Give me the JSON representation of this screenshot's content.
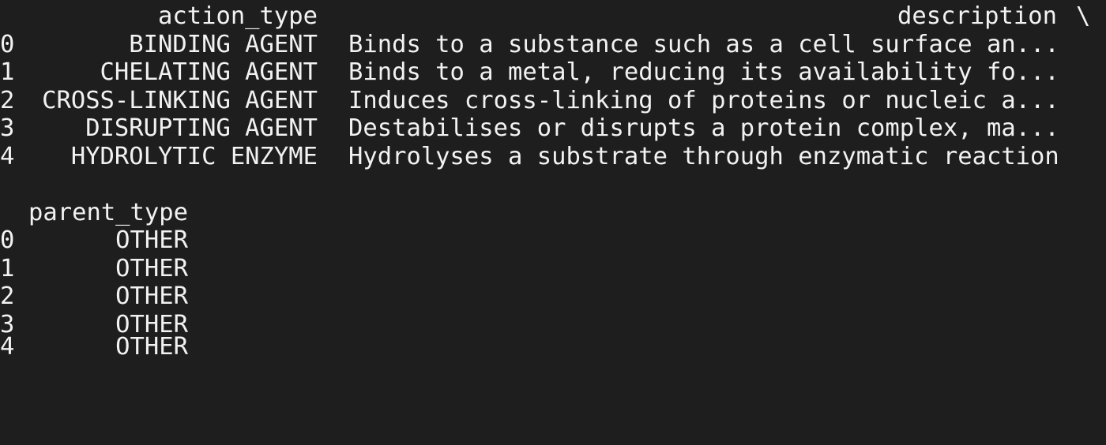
{
  "table1": {
    "headers": {
      "action_type": "action_type",
      "description": "description",
      "continuation": "\\"
    },
    "rows": [
      {
        "index": "0",
        "action_type": "BINDING AGENT",
        "description": "Binds to a substance such as a cell surface an..."
      },
      {
        "index": "1",
        "action_type": "CHELATING AGENT",
        "description": "Binds to a metal, reducing its availability fo..."
      },
      {
        "index": "2",
        "action_type": "CROSS-LINKING AGENT",
        "description": "Induces cross-linking of proteins or nucleic a..."
      },
      {
        "index": "3",
        "action_type": "DISRUPTING AGENT",
        "description": "Destabilises or disrupts a protein complex, ma..."
      },
      {
        "index": "4",
        "action_type": "HYDROLYTIC ENZYME",
        "description": "Hydrolyses a substrate through enzymatic reaction"
      }
    ]
  },
  "table2": {
    "headers": {
      "parent_type": "parent_type"
    },
    "rows": [
      {
        "index": "0",
        "parent_type": "OTHER"
      },
      {
        "index": "1",
        "parent_type": "OTHER"
      },
      {
        "index": "2",
        "parent_type": "OTHER"
      },
      {
        "index": "3",
        "parent_type": "OTHER"
      },
      {
        "index": "4",
        "parent_type": "OTHER"
      }
    ]
  },
  "colors": {
    "background": "#1e1e1e",
    "text": "#f2f2f2"
  }
}
